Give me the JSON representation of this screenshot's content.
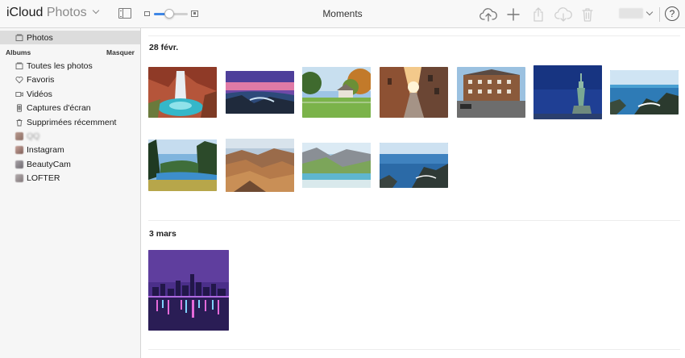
{
  "app": {
    "brand_main": "iCloud",
    "brand_sub": "Photos",
    "view_title": "Moments",
    "zoom_level": 0.45
  },
  "toolbar": {
    "icons": [
      "upload-icon",
      "add-icon",
      "share-icon",
      "download-icon",
      "trash-icon",
      "sidebar-toggle-icon",
      "help-icon"
    ],
    "help_label": "?"
  },
  "sidebar": {
    "top_item": {
      "label": "Photos",
      "icon": "photos-icon"
    },
    "albums_header": "Albums",
    "albums_hide": "Masquer",
    "items": [
      {
        "label": "Toutes les photos",
        "icon": "all-photos-icon"
      },
      {
        "label": "Favoris",
        "icon": "heart-icon"
      },
      {
        "label": "Vidéos",
        "icon": "video-icon"
      },
      {
        "label": "Captures d'écran",
        "icon": "screenshot-icon"
      },
      {
        "label": "Supprimées récemment",
        "icon": "trash-icon"
      },
      {
        "label": "QQ",
        "icon": "album-thumb-icon"
      },
      {
        "label": "Instagram",
        "icon": "album-thumb-icon"
      },
      {
        "label": "BeautyCam",
        "icon": "album-thumb-icon"
      },
      {
        "label": "LOFTER",
        "icon": "album-thumb-icon"
      }
    ]
  },
  "moments": [
    {
      "date": "28 févr.",
      "photos": [
        "waterfall-canyon",
        "coastal-sunset",
        "farm-barn-field",
        "cobblestone-alley",
        "brick-hotel-street",
        "statue-of-liberty",
        "rocky-coast-sea",
        "river-forest",
        "grand-canyon",
        "alpine-lake",
        "cliff-ocean"
      ]
    },
    {
      "date": "3 mars",
      "photos": [
        "city-night-skyline"
      ]
    }
  ],
  "colors": {
    "accent": "#3f87e6",
    "sidebar_bg": "#f6f6f6",
    "sidebar_active": "#dcdcdc",
    "topbar_bg": "#f8f8f8"
  }
}
